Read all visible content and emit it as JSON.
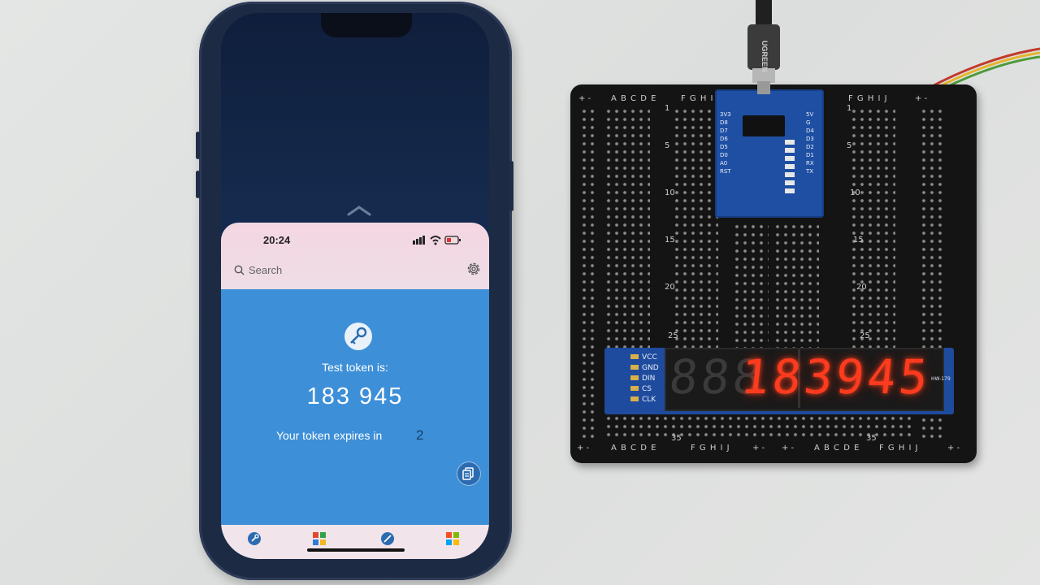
{
  "phone": {
    "status_bar": {
      "time": "20:24"
    },
    "search": {
      "placeholder": "Search"
    },
    "token_card": {
      "label": "Test token is:",
      "token": "183 945",
      "expires_label": "Your token expires in",
      "expires_count": "2"
    },
    "colors": {
      "card_blue": "#3d8fd7",
      "sheet_pink": "#f4d6e1"
    },
    "icons": [
      "search-icon",
      "gear-icon",
      "key-icon",
      "copy-icon",
      "tab-key-icon",
      "tab-grid-icon",
      "tab-pencil-icon",
      "tab-apps-icon"
    ]
  },
  "board": {
    "columns_left": "A B C D E",
    "columns_right": "F G H I J",
    "rows": [
      "1",
      "5",
      "10",
      "15",
      "20",
      "25",
      "35"
    ],
    "rail": "+ -",
    "controller_pins_left": [
      "3V3",
      "D8",
      "D7",
      "D6",
      "D5",
      "D0",
      "A0",
      "RST"
    ],
    "controller_pins_right": [
      "5V",
      "G",
      "D4",
      "D3",
      "D2",
      "D1",
      "RX",
      "TX"
    ],
    "cable_brand": "UGREEN",
    "display": {
      "pins": [
        "VCC",
        "GND",
        "DIN",
        "CS",
        "CLK"
      ],
      "model": "HW-179",
      "value": "183945",
      "digit_color": "#ff3b1f"
    }
  }
}
